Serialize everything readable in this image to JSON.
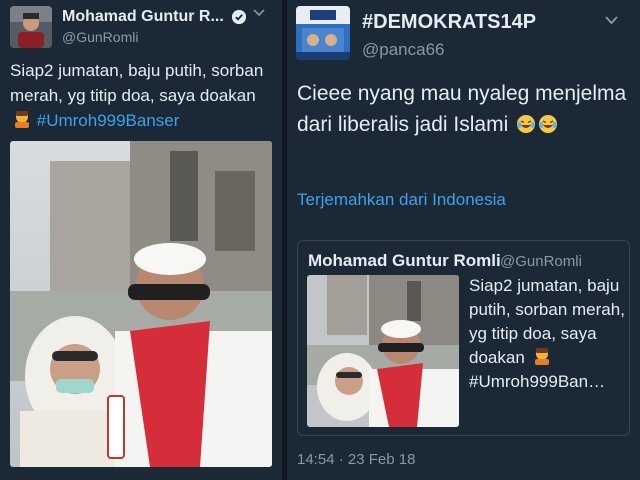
{
  "left_tweet": {
    "display_name": "Mohamad Guntur R...",
    "handle": "@GunRomli",
    "text_before": "Siap2 jumatan, baju putih, sorban merah, yg titip doa, saya doakan",
    "hashtag": "#Umroh999Banser",
    "avatar_icon": "user-avatar-icon",
    "verified_icon": "verified-check-icon",
    "menu_icon": "chevron-down-icon"
  },
  "right_tweet": {
    "display_name": "#DEMOKRATS14P",
    "handle": "@panca66",
    "text": "Cieee nyang mau nyaleg menjelma dari liberalis jadi Islami",
    "emoji": [
      "face-with-tears-of-joy",
      "face-with-tears-of-joy"
    ],
    "translate_label": "Terjemahkan dari Indonesia",
    "timestamp": "14:54 · 23 Feb 18",
    "menu_icon": "chevron-down-icon",
    "quoted_tweet": {
      "display_name": "Mohamad Guntur Romli",
      "handle": "@GunRomli",
      "text": "Siap2 jumatan, baju putih, sorban merah, yg titip doa, saya doakan",
      "hashtag": "#Umroh999Ban…"
    }
  },
  "colors": {
    "background": "#1b2836",
    "text": "#e6ecf0",
    "muted": "#8899a6",
    "link": "#3fa2e8"
  }
}
